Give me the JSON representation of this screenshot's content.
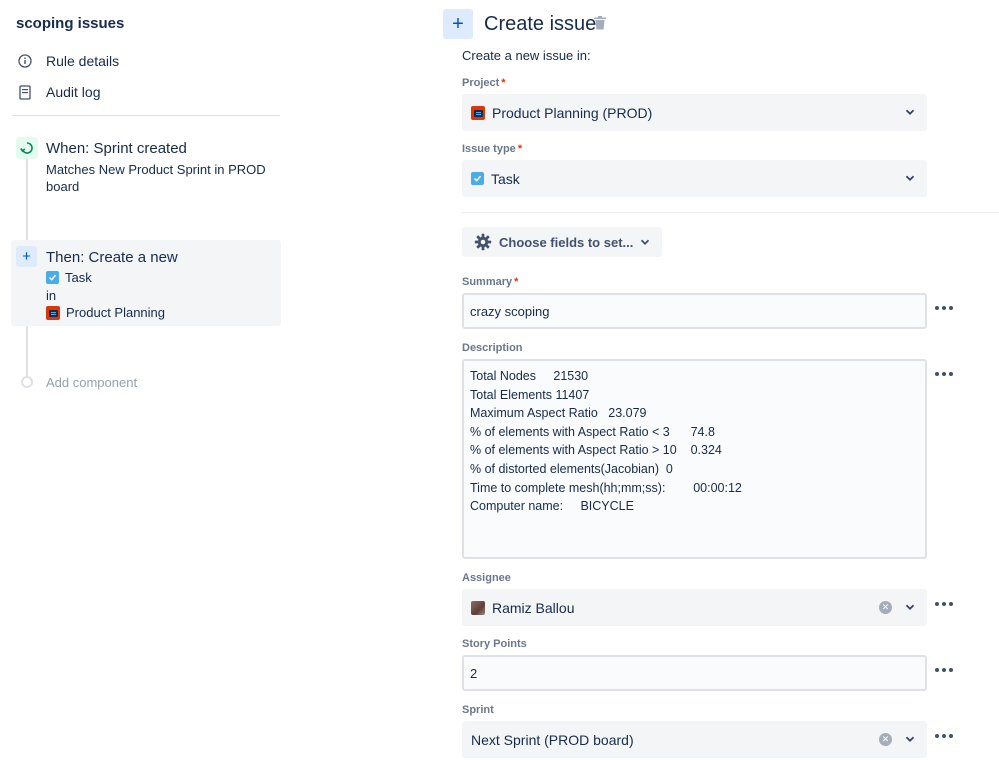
{
  "sidebar": {
    "rule_title": "scoping issues",
    "links": [
      {
        "label": "Rule details",
        "icon": "info-icon"
      },
      {
        "label": "Audit log",
        "icon": "audit-log-icon"
      }
    ],
    "trigger": {
      "title": "When: Sprint created",
      "description": "Matches New Product Sprint in PROD board"
    },
    "action": {
      "title": "Then: Create a new",
      "issue_type": "Task",
      "in_label": "in",
      "project": "Product Planning"
    },
    "add_component": "Add component"
  },
  "editor": {
    "title": "Create issue",
    "subtitle": "Create a new issue in:",
    "project": {
      "label": "Project",
      "required": "*",
      "value": "Product Planning (PROD)"
    },
    "issue_type": {
      "label": "Issue type",
      "required": "*",
      "value": "Task"
    },
    "choose_fields": "Choose fields to set...",
    "summary": {
      "label": "Summary",
      "required": "*",
      "value": "crazy scoping"
    },
    "description": {
      "label": "Description",
      "lines": [
        "Total Nodes     21530",
        "Total Elements 11407",
        "Maximum Aspect Ratio   23.079",
        "% of elements with Aspect Ratio < 3      74.8",
        "% of elements with Aspect Ratio > 10    0.324",
        "% of distorted elements(Jacobian)  0",
        "Time to complete mesh(hh;mm;ss):        00:00:12",
        "Computer name:     BICYCLE"
      ]
    },
    "assignee": {
      "label": "Assignee",
      "value": "Ramiz Ballou"
    },
    "story_points": {
      "label": "Story Points",
      "value": "2"
    },
    "sprint": {
      "label": "Sprint",
      "value": "Next Sprint (PROD board)"
    }
  },
  "colors": {
    "accent": "#0052cc",
    "required": "#de350b",
    "task": "#4bade8",
    "trigger_bg": "#e3fcef"
  }
}
